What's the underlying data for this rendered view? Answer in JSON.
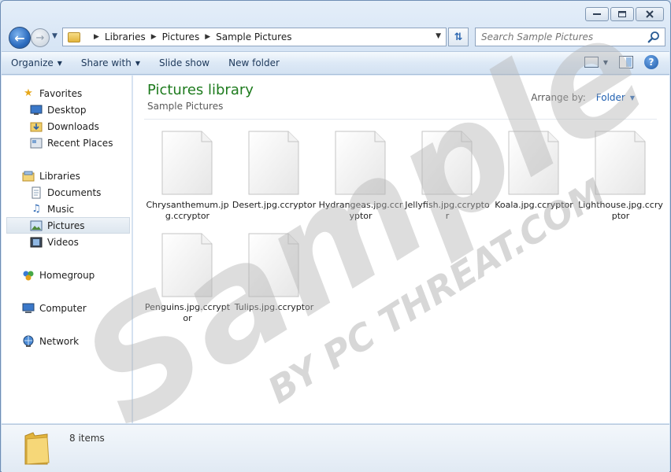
{
  "window": {
    "caption_buttons": [
      "minimize",
      "maximize",
      "close"
    ]
  },
  "nav": {
    "breadcrumb": [
      "Libraries",
      "Pictures",
      "Sample Pictures"
    ],
    "search_placeholder": "Search Sample Pictures"
  },
  "toolbar": {
    "organize": "Organize",
    "share_with": "Share with",
    "slide_show": "Slide show",
    "new_folder": "New folder"
  },
  "sidebar": {
    "favorites": {
      "label": "Favorites",
      "items": [
        "Desktop",
        "Downloads",
        "Recent Places"
      ]
    },
    "libraries": {
      "label": "Libraries",
      "items": [
        "Documents",
        "Music",
        "Pictures",
        "Videos"
      ]
    },
    "homegroup": "Homegroup",
    "computer": "Computer",
    "network": "Network",
    "selected": "Pictures"
  },
  "content": {
    "title": "Pictures library",
    "subtitle": "Sample Pictures",
    "arrange_label": "Arrange by:",
    "arrange_value": "Folder",
    "files": [
      "Chrysanthemum.jpg.ccryptor",
      "Desert.jpg.ccryptor",
      "Hydrangeas.jpg.ccryptor",
      "Jellyfish.jpg.ccryptor",
      "Koala.jpg.ccryptor",
      "Lighthouse.jpg.ccryptor",
      "Penguins.jpg.ccryptor",
      "Tulips.jpg.ccryptor"
    ]
  },
  "details": {
    "item_count": "8 items"
  },
  "watermark": {
    "line1": "Sample",
    "line2": "BY PC THREAT.COM"
  },
  "colors": {
    "library_title": "#1e7b1e",
    "link_blue": "#1e5fb0",
    "window_frame": "#cfe0f1"
  }
}
